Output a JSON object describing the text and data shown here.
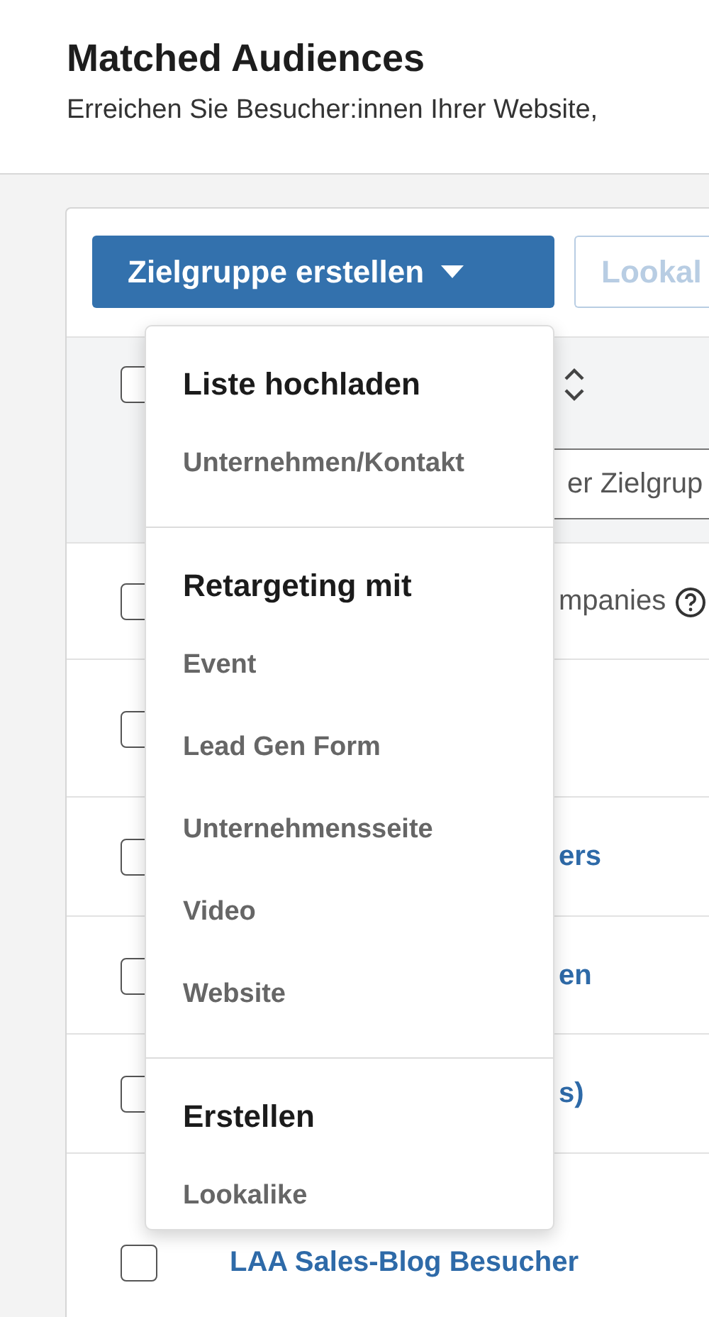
{
  "header": {
    "title": "Matched Audiences",
    "subtitle": "Erreichen Sie Besucher:innen Ihrer Website,"
  },
  "toolbar": {
    "create_button": "Zielgruppe erstellen",
    "lookalike_button": "Lookal"
  },
  "table": {
    "header": {
      "checked": false,
      "search": {
        "value": "er Zielgrup"
      }
    },
    "rows": [
      {
        "kind": "text",
        "name": "mpanies",
        "checked": false
      },
      {
        "kind": "link",
        "checked": false
      },
      {
        "kind": "link",
        "name": "ers",
        "checked": false
      },
      {
        "kind": "link",
        "name": "en",
        "checked": false
      },
      {
        "kind": "link",
        "name": "s)",
        "checked": false
      },
      {
        "kind": "link",
        "name": "LAA Sales-Blog Besucher",
        "checked": false
      }
    ]
  },
  "menu": {
    "sections": [
      {
        "heading": "Liste hochladen",
        "items": [
          "Unternehmen/Kontakt"
        ]
      },
      {
        "heading": "Retargeting mit",
        "items": [
          "Event",
          "Lead Gen Form",
          "Unternehmensseite",
          "Video",
          "Website"
        ]
      },
      {
        "heading": "Erstellen",
        "items": [
          "Lookalike"
        ]
      }
    ]
  }
}
